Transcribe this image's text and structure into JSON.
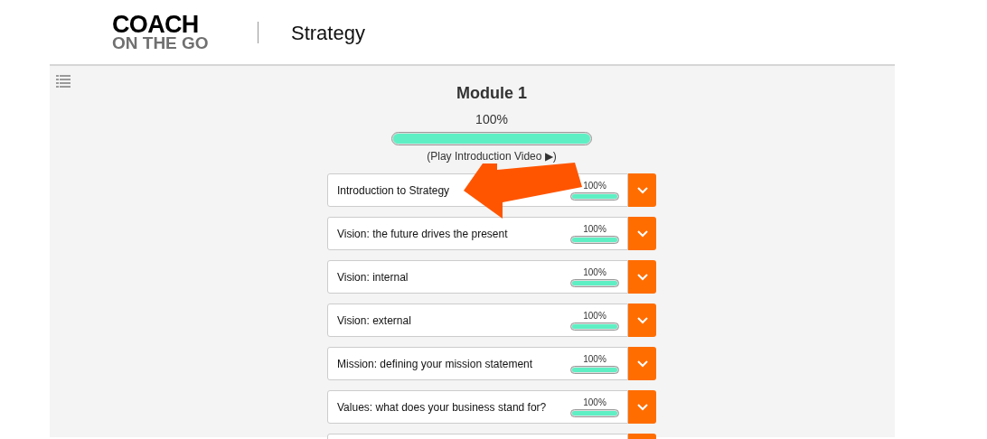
{
  "header": {
    "logo": {
      "line_1": "COACH",
      "line_2": "ON THE GO"
    },
    "title": "Strategy"
  },
  "module": {
    "title": "Module 1",
    "progress_text": "100%",
    "level": 1,
    "video_link": "(Play Introduction Video ▶)"
  },
  "lessons": [
    {
      "kind": "full",
      "title": "Introduction to Strategy",
      "progress_text": "100%",
      "level": 1
    },
    {
      "kind": "full",
      "title": "Vision: the future drives the present",
      "progress_text": "100%",
      "level": 1
    },
    {
      "kind": "full",
      "title": "Vision: internal",
      "progress_text": "100%",
      "level": 1
    },
    {
      "kind": "full",
      "title": "Vision: external",
      "progress_text": "100%",
      "level": 1
    },
    {
      "kind": "full",
      "title": "Mission: defining your mission statement",
      "progress_text": "100%",
      "level": 1
    },
    {
      "kind": "full",
      "title": "Values: what does your business stand for?",
      "progress_text": "100%",
      "level": 1
    },
    {
      "kind": "cut"
    }
  ]
}
